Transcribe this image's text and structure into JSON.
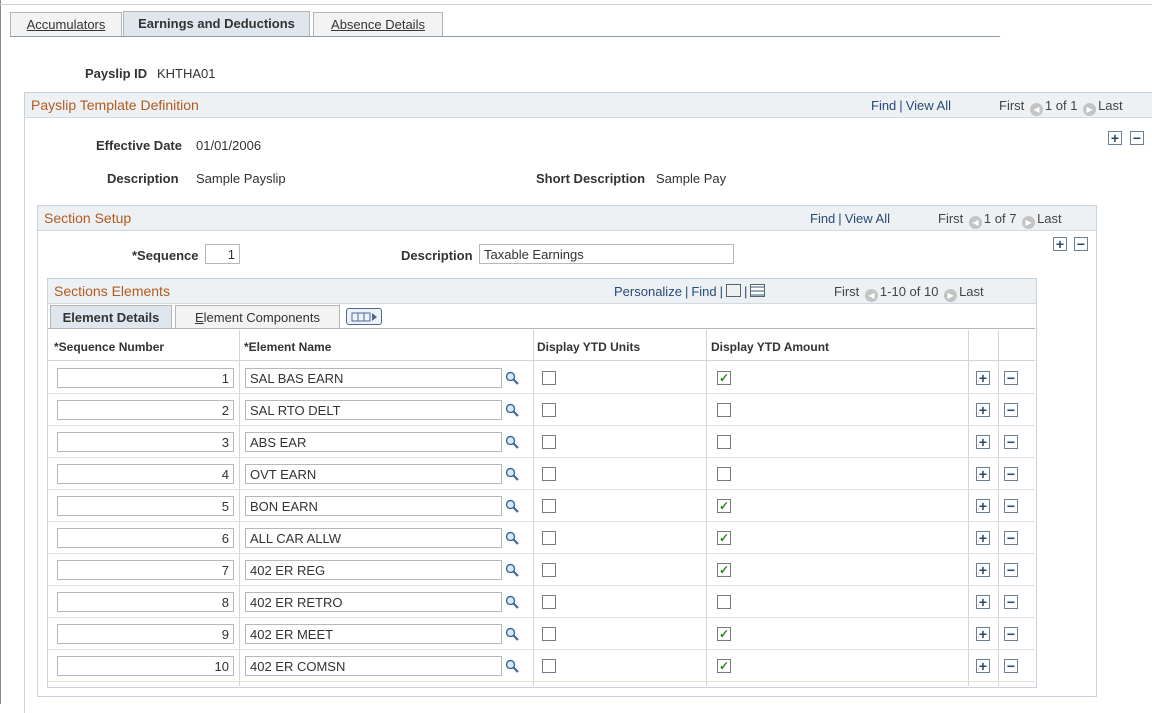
{
  "tabs": [
    {
      "pre": "",
      "ul": "A",
      "post": "ccumulators"
    },
    {
      "pre": "",
      "ul": "",
      "post": "Earnings and Deductions"
    },
    {
      "pre": "A",
      "ul": "b",
      "post": "sence Details"
    }
  ],
  "payslip": {
    "label": "Payslip ID",
    "value": "KHTHA01"
  },
  "template": {
    "title": "Payslip Template Definition",
    "find": "Find",
    "view_all": "View All",
    "first": "First",
    "pager": "1 of 1",
    "last": "Last",
    "effective_date_label": "Effective Date",
    "effective_date": "01/01/2006",
    "description_label": "Description",
    "description": "Sample Payslip",
    "short_description_label": "Short Description",
    "short_description": "Sample Pay"
  },
  "section": {
    "title": "Section Setup",
    "find": "Find",
    "view_all": "View All",
    "first": "First",
    "pager": "1 of 7",
    "last": "Last",
    "sequence_label": "*Sequence",
    "sequence": "1",
    "description_label": "Description",
    "description": "Taxable Earnings"
  },
  "elements": {
    "title": "Sections Elements",
    "personalize": "Personalize",
    "find": "Find",
    "first": "First",
    "pager": "1-10 of 10",
    "last": "Last",
    "tab_details": "Element Details",
    "tab_components_ul": "E",
    "tab_components_rest": "lement Components",
    "col_seq": "*Sequence Number",
    "col_name": "*Element Name",
    "col_units": "Display YTD Units",
    "col_amount": "Display YTD Amount",
    "rows": [
      {
        "seq": "1",
        "name": "SAL BAS EARN",
        "units": false,
        "amount": true
      },
      {
        "seq": "2",
        "name": "SAL RTO DELT",
        "units": false,
        "amount": false
      },
      {
        "seq": "3",
        "name": "ABS EAR",
        "units": false,
        "amount": false
      },
      {
        "seq": "4",
        "name": "OVT EARN",
        "units": false,
        "amount": false
      },
      {
        "seq": "5",
        "name": "BON EARN",
        "units": false,
        "amount": true
      },
      {
        "seq": "6",
        "name": "ALL CAR ALLW",
        "units": false,
        "amount": true
      },
      {
        "seq": "7",
        "name": "402 ER REG",
        "units": false,
        "amount": true
      },
      {
        "seq": "8",
        "name": "402 ER RETRO",
        "units": false,
        "amount": false
      },
      {
        "seq": "9",
        "name": "402 ER MEET",
        "units": false,
        "amount": true
      },
      {
        "seq": "10",
        "name": "402 ER COMSN",
        "units": false,
        "amount": true
      }
    ]
  },
  "colors": {
    "title": "#b35a1f",
    "link": "#274a78",
    "check": "#2a8a2a"
  }
}
